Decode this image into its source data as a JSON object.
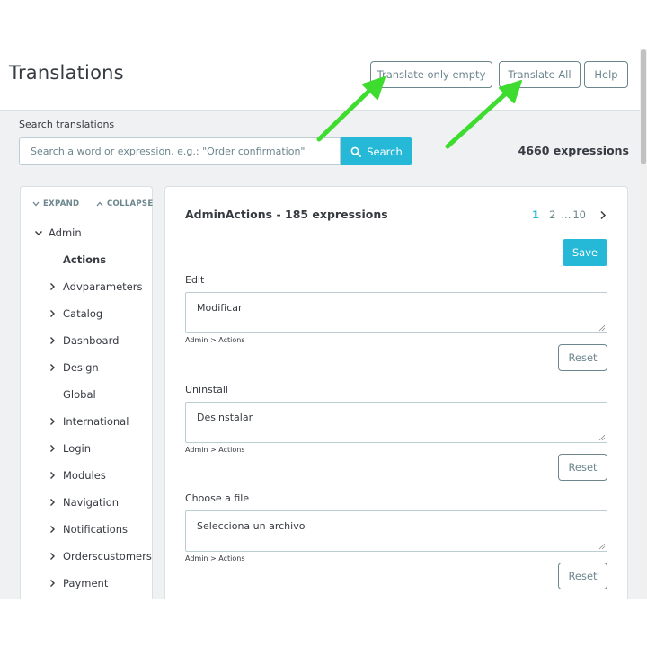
{
  "header": {
    "title": "Translations",
    "buttons": {
      "translate_empty": "Translate only empty",
      "translate_all": "Translate All",
      "help": "Help"
    }
  },
  "search": {
    "label": "Search translations",
    "placeholder": "Search a word or expression, e.g.: \"Order confirmation\"",
    "button": "Search",
    "count": "4660 expressions"
  },
  "tree": {
    "expand": "EXPAND",
    "collapse": "COLLAPSE",
    "root": "Admin",
    "items": [
      {
        "label": "Actions",
        "has_children": false,
        "selected": true
      },
      {
        "label": "Advparameters",
        "has_children": true
      },
      {
        "label": "Catalog",
        "has_children": true
      },
      {
        "label": "Dashboard",
        "has_children": true
      },
      {
        "label": "Design",
        "has_children": true
      },
      {
        "label": "Global",
        "has_children": false
      },
      {
        "label": "International",
        "has_children": true
      },
      {
        "label": "Login",
        "has_children": true
      },
      {
        "label": "Modules",
        "has_children": true
      },
      {
        "label": "Navigation",
        "has_children": true
      },
      {
        "label": "Notifications",
        "has_children": true
      },
      {
        "label": "Orderscustomers",
        "has_children": true
      },
      {
        "label": "Payment",
        "has_children": true
      }
    ]
  },
  "main": {
    "domain_title": "AdminActions - 185 expressions",
    "pagination": {
      "current": "1",
      "next": "2",
      "ellipsis": "...",
      "last": "10"
    },
    "save": "Save",
    "entries": [
      {
        "label": "Edit",
        "value": "Modificar",
        "path": "Admin > Actions",
        "reset": "Reset"
      },
      {
        "label": "Uninstall",
        "value": "Desinstalar",
        "path": "Admin > Actions",
        "reset": "Reset"
      },
      {
        "label": "Choose a file",
        "value": "Selecciona un archivo",
        "path": "Admin > Actions",
        "reset": "Reset"
      }
    ]
  },
  "colors": {
    "accent": "#25b9d7",
    "annotation_arrow": "#3ddc2f",
    "text": "#363a41",
    "muted": "#6c868e"
  }
}
